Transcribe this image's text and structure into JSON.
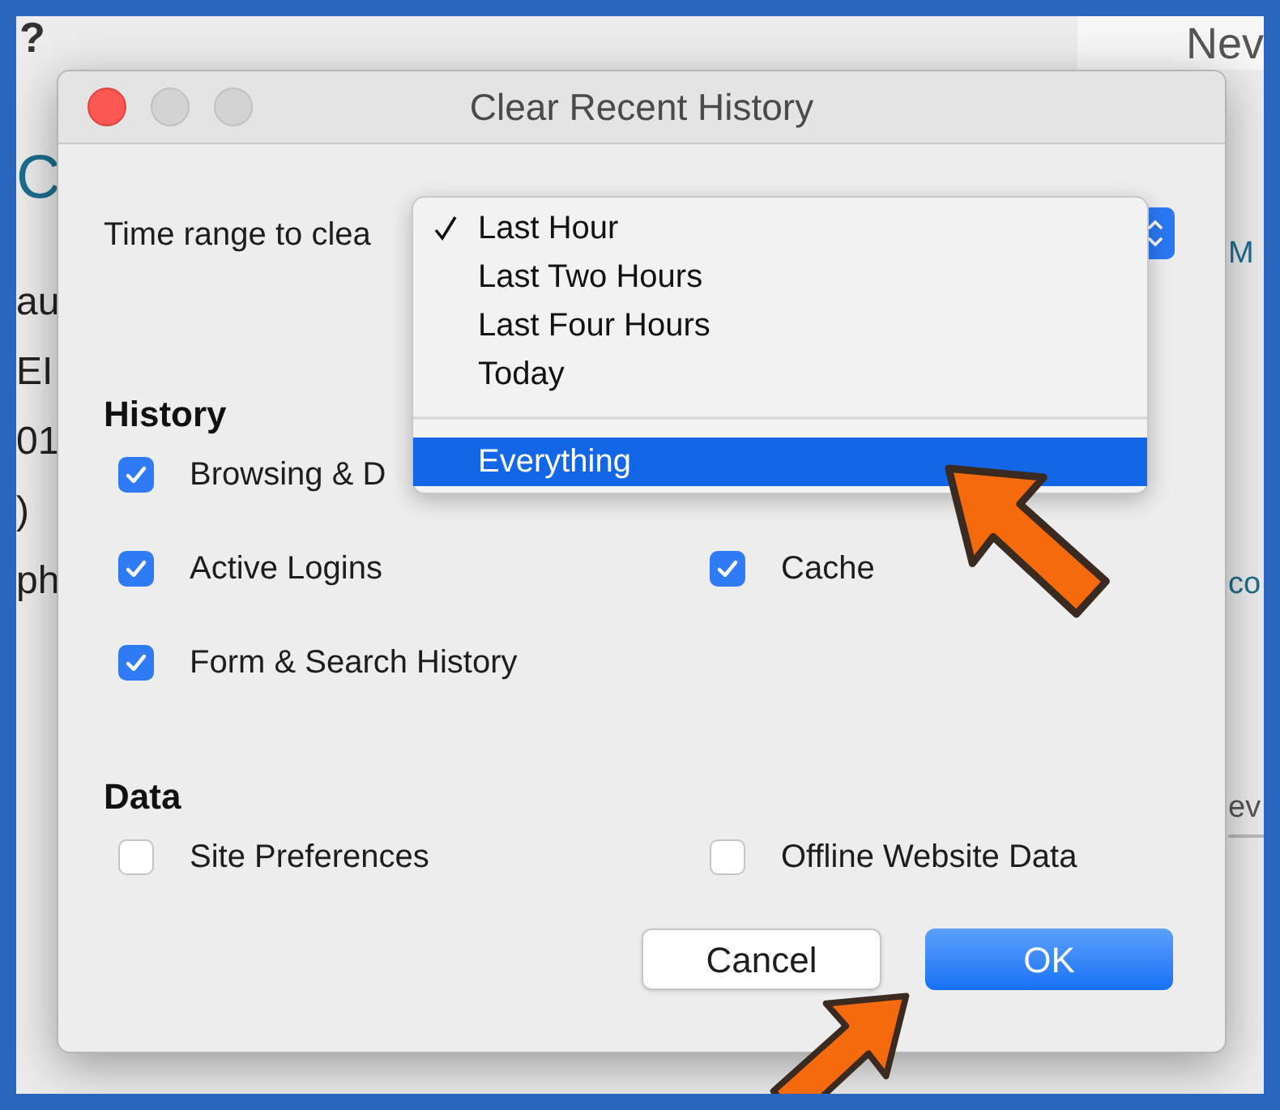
{
  "background_page": {
    "top_left": "?",
    "top_right": "Nev",
    "left_fragments": [
      {
        "text": "C",
        "kind": "link"
      },
      {
        "text": "au",
        "kind": "text"
      },
      {
        "text": "EI",
        "kind": "text"
      },
      {
        "text": "01",
        "kind": "text"
      },
      {
        "text": ")",
        "kind": "text"
      },
      {
        "text": "ph",
        "kind": "text"
      }
    ],
    "right_fragments": [
      {
        "text": "M",
        "kind": "link"
      },
      {
        "text": "co",
        "kind": "link"
      },
      {
        "text": "ev",
        "kind": "text"
      }
    ]
  },
  "dialog": {
    "title": "Clear Recent History",
    "time_range": {
      "label": "Time range to clea",
      "menu": [
        {
          "kind": "option",
          "label": "Last Hour",
          "checked": true,
          "selected": false
        },
        {
          "kind": "option",
          "label": "Last Two Hours",
          "checked": false,
          "selected": false
        },
        {
          "kind": "option",
          "label": "Last Four Hours",
          "checked": false,
          "selected": false
        },
        {
          "kind": "option",
          "label": "Today",
          "checked": false,
          "selected": false
        },
        {
          "kind": "separator"
        },
        {
          "kind": "option",
          "label": "Everything",
          "checked": false,
          "selected": true
        }
      ]
    },
    "sections": [
      {
        "heading": "History",
        "rows": [
          [
            {
              "label": "Browsing & D",
              "checked": true
            }
          ],
          [
            {
              "label": "Active Logins",
              "checked": true
            },
            {
              "label": "Cache",
              "checked": true
            }
          ],
          [
            {
              "label": "Form & Search History",
              "checked": true
            }
          ]
        ]
      },
      {
        "heading": "Data",
        "rows": [
          [
            {
              "label": "Site Preferences",
              "checked": false
            },
            {
              "label": "Offline Website Data",
              "checked": false
            }
          ]
        ]
      }
    ],
    "buttons": [
      {
        "label": "Cancel",
        "default": false
      },
      {
        "label": "OK",
        "default": true
      }
    ]
  }
}
